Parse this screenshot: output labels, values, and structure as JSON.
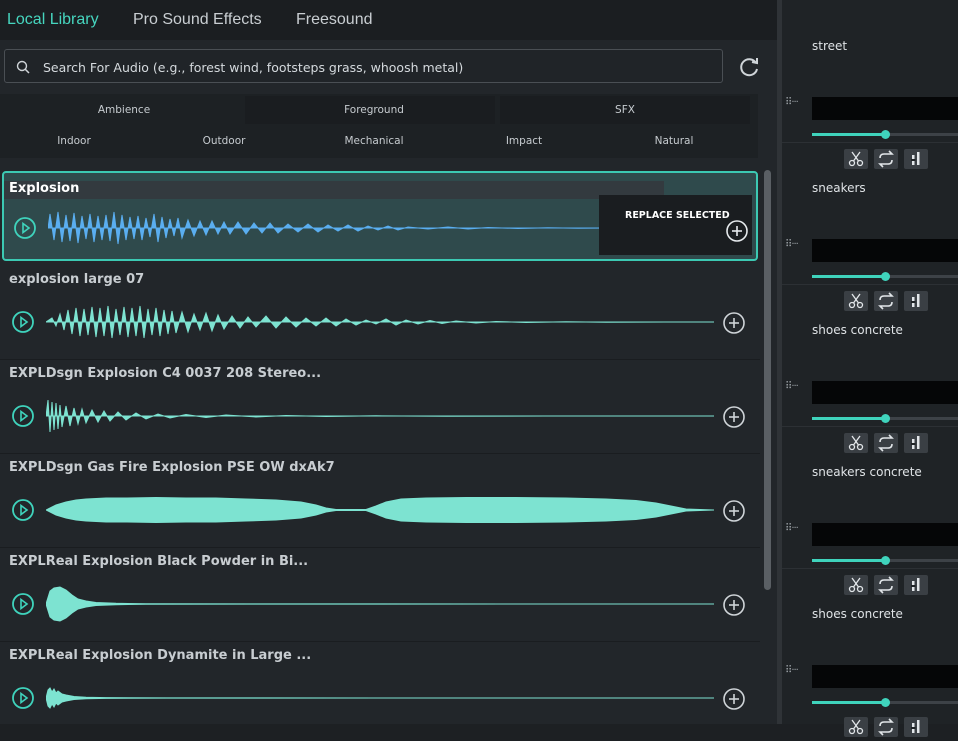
{
  "tabs": [
    {
      "label": "Local Library",
      "active": true
    },
    {
      "label": "Pro Sound Effects",
      "active": false
    },
    {
      "label": "Freesound",
      "active": false
    }
  ],
  "search": {
    "placeholder": "Search For Audio (e.g., forest wind, footsteps grass, whoosh metal)",
    "icon": "search-icon"
  },
  "refresh_icon": "refresh-icon",
  "categories": {
    "row1": [
      "Ambience",
      "Foreground",
      "SFX"
    ],
    "row2": [
      "Indoor",
      "Outdoor",
      "Mechanical",
      "Impact",
      "Natural"
    ]
  },
  "results": [
    {
      "title": "Explosion",
      "selected": true,
      "action": "REPLACE SELECTED"
    },
    {
      "title": "explosion large 07",
      "selected": false
    },
    {
      "title": "EXPLDsgn Explosion C4 0037 208 Stereo...",
      "selected": false
    },
    {
      "title": "EXPLDsgn Gas Fire Explosion PSE OW dxAk7",
      "selected": false
    },
    {
      "title": "EXPLReal Explosion Black Powder in Bi...",
      "selected": false
    },
    {
      "title": "EXPLReal Explosion Dynamite in Large ...",
      "selected": false
    }
  ],
  "tracks": [
    {
      "name": "street",
      "volume": 0.5
    },
    {
      "name": "sneakers",
      "volume": 0.5
    },
    {
      "name": "shoes concrete",
      "volume": 0.5
    },
    {
      "name": "sneakers concrete",
      "volume": 0.5
    },
    {
      "name": "shoes concrete",
      "volume": 0.5
    }
  ],
  "colors": {
    "accent": "#46d6bf",
    "wave": "#7de3d1",
    "wave_selected": "#5aaef0"
  }
}
